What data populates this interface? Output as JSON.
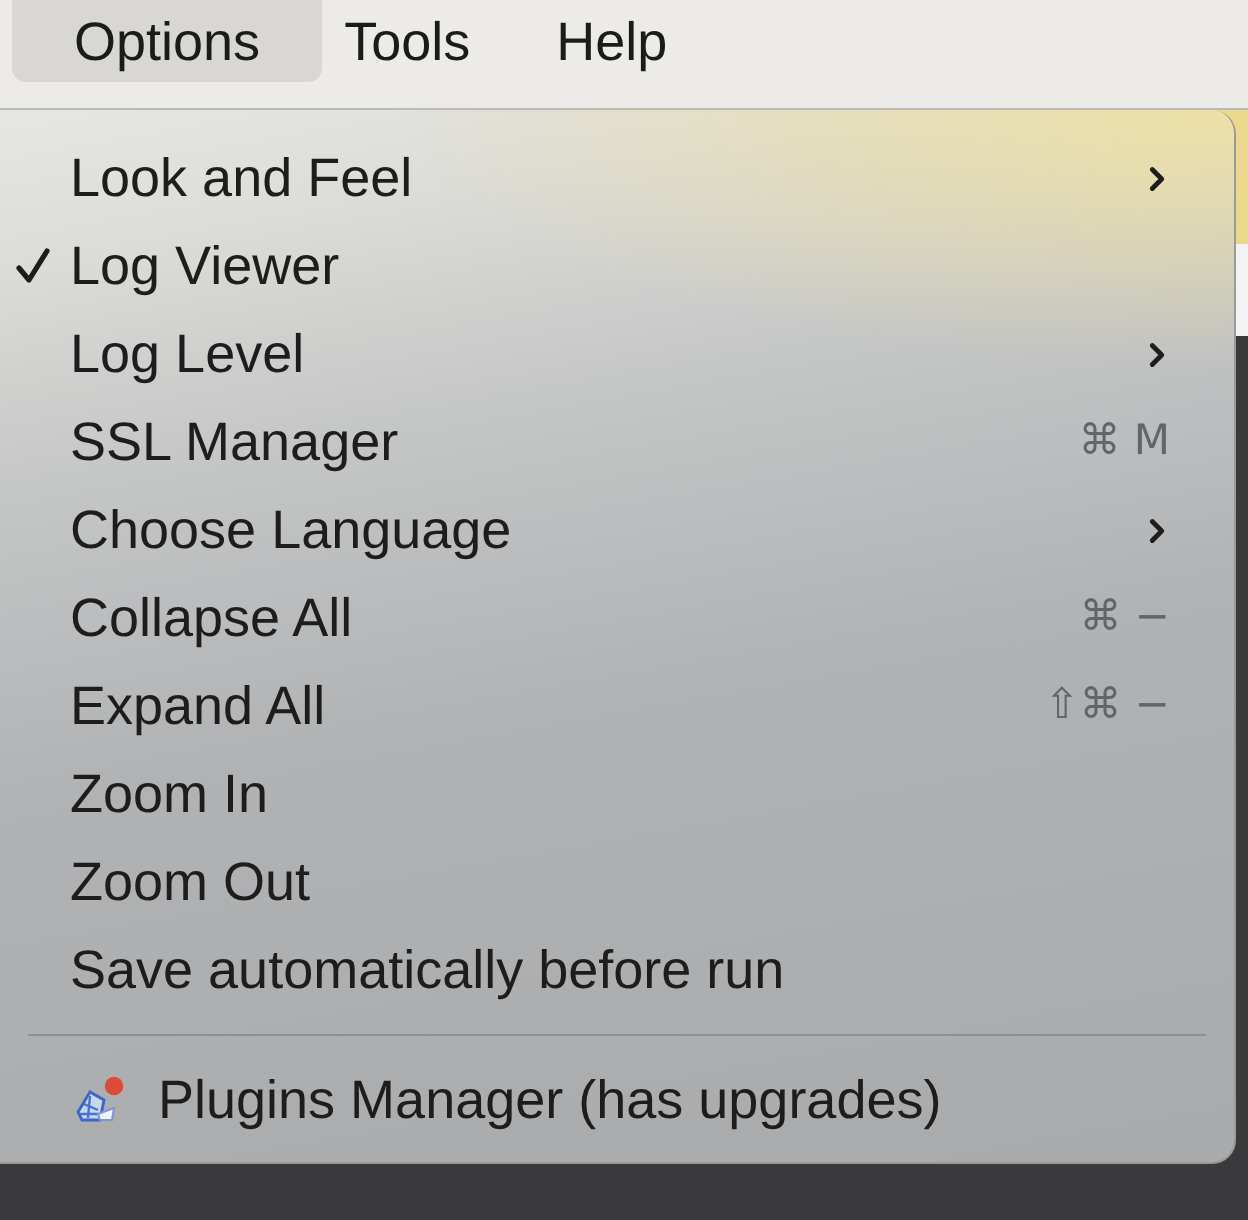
{
  "menu_bar": {
    "items": [
      {
        "label": "Options",
        "selected": true
      },
      {
        "label": "Tools",
        "selected": false
      },
      {
        "label": "Help",
        "selected": false
      }
    ]
  },
  "menu": {
    "items": [
      {
        "kind": "item",
        "label": "Look and Feel",
        "checked": false,
        "submenu": true
      },
      {
        "kind": "item",
        "label": "Log Viewer",
        "checked": true,
        "submenu": false
      },
      {
        "kind": "item",
        "label": "Log Level",
        "checked": false,
        "submenu": true
      },
      {
        "kind": "item",
        "label": "SSL Manager",
        "checked": false,
        "submenu": false,
        "shortcut": "⌘ M"
      },
      {
        "kind": "item",
        "label": "Choose Language",
        "checked": false,
        "submenu": true
      },
      {
        "kind": "item",
        "label": "Collapse All",
        "checked": false,
        "submenu": false,
        "shortcut": "⌘ −"
      },
      {
        "kind": "item",
        "label": "Expand All",
        "checked": false,
        "submenu": false,
        "shortcut": "⇧⌘ −"
      },
      {
        "kind": "item",
        "label": "Zoom In",
        "checked": false,
        "submenu": false
      },
      {
        "kind": "item",
        "label": "Zoom Out",
        "checked": false,
        "submenu": false
      },
      {
        "kind": "item",
        "label": "Save automatically before run",
        "checked": false,
        "submenu": false
      },
      {
        "kind": "separator"
      },
      {
        "kind": "plugin",
        "label": "Plugins Manager (has upgrades)",
        "notification": true
      }
    ]
  }
}
